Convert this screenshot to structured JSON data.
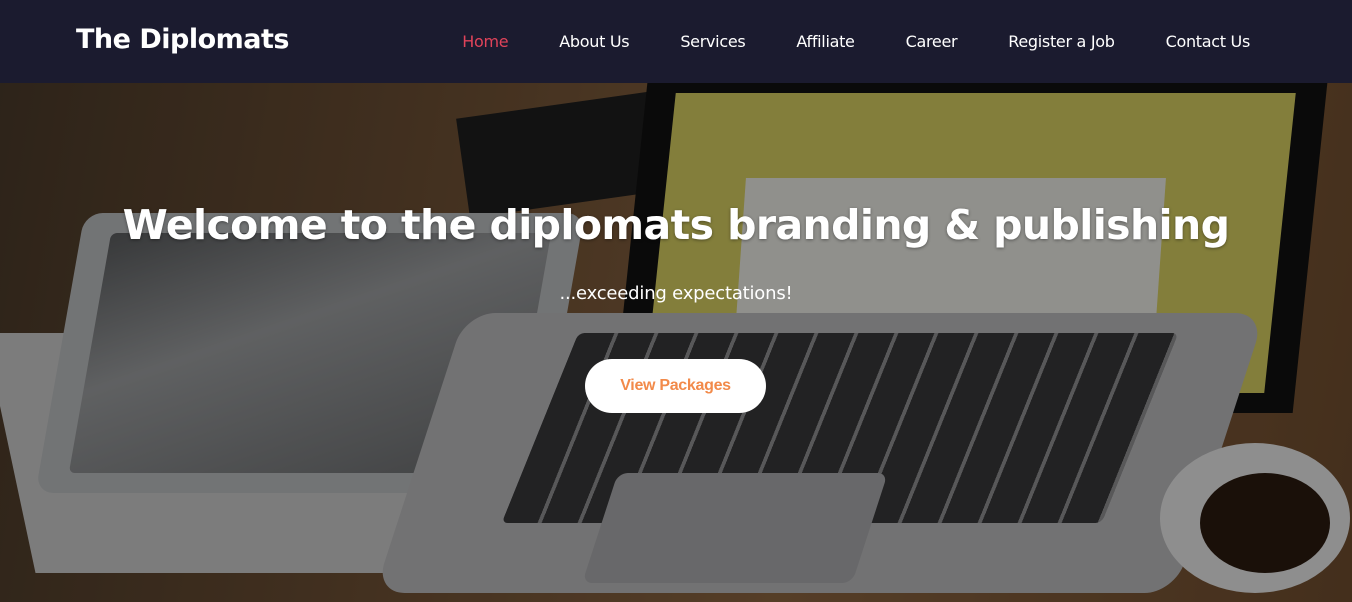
{
  "nav": {
    "brand": "The Diplomats",
    "items": [
      {
        "label": "Home",
        "active": true
      },
      {
        "label": "About Us"
      },
      {
        "label": "Services"
      },
      {
        "label": "Affiliate"
      },
      {
        "label": "Career"
      },
      {
        "label": "Register a Job"
      },
      {
        "label": "Contact Us"
      }
    ],
    "active_color": "#e0435a"
  },
  "hero": {
    "title": "Welcome to the diplomats branding & publishing",
    "subtitle": "...exceeding expectations!",
    "cta_label": "View Packages",
    "cta_color": "#f28a4a"
  }
}
